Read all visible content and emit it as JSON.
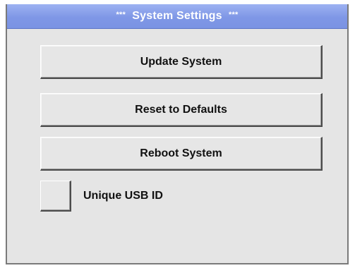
{
  "title": {
    "prefix": "***",
    "text": "System Settings",
    "suffix": "***"
  },
  "buttons": {
    "update": "Update System",
    "reset": "Reset to Defaults",
    "reboot": "Reboot System"
  },
  "options": {
    "unique_usb_id": {
      "label": "Unique USB ID",
      "checked": false
    }
  },
  "colors": {
    "title_bar": "#7f97e6",
    "title_text": "#ffffff",
    "panel_background": "#e5e5e5",
    "button_face": "#e6e6e6"
  }
}
